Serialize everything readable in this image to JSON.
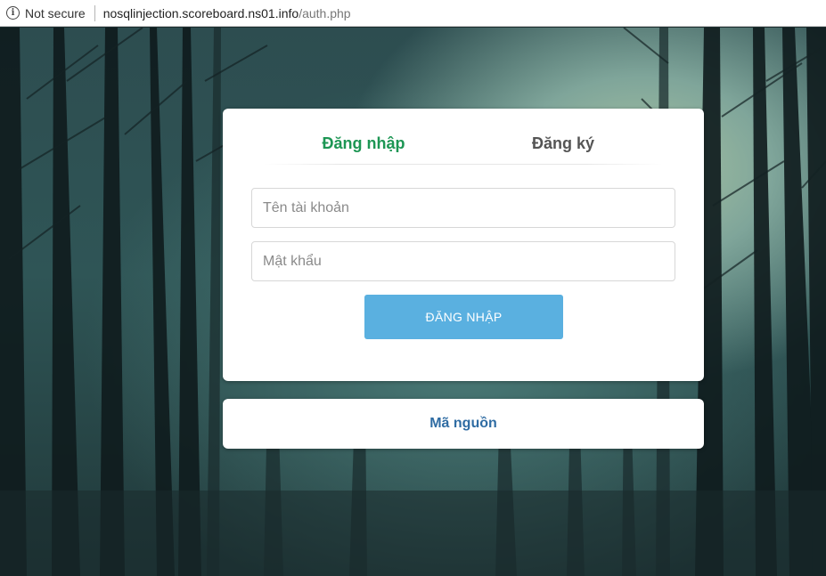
{
  "browser": {
    "security_label": "Not secure",
    "url_host": "nosqlinjection.scoreboard.ns01.info",
    "url_path": "/auth.php",
    "info_icon": "info-icon"
  },
  "auth": {
    "tabs": [
      {
        "label": "Đăng nhập",
        "active": true
      },
      {
        "label": "Đăng ký",
        "active": false
      }
    ],
    "username_placeholder": "Tên tài khoản",
    "username_value": "",
    "password_placeholder": "Mật khẩu",
    "password_value": "",
    "submit_label": "ĐĂNG NHẬP"
  },
  "footer": {
    "source_link": "Mã nguồn"
  },
  "colors": {
    "active_tab": "#1d9654",
    "submit_bg": "#5ab0e0",
    "link": "#2f6ca3"
  }
}
